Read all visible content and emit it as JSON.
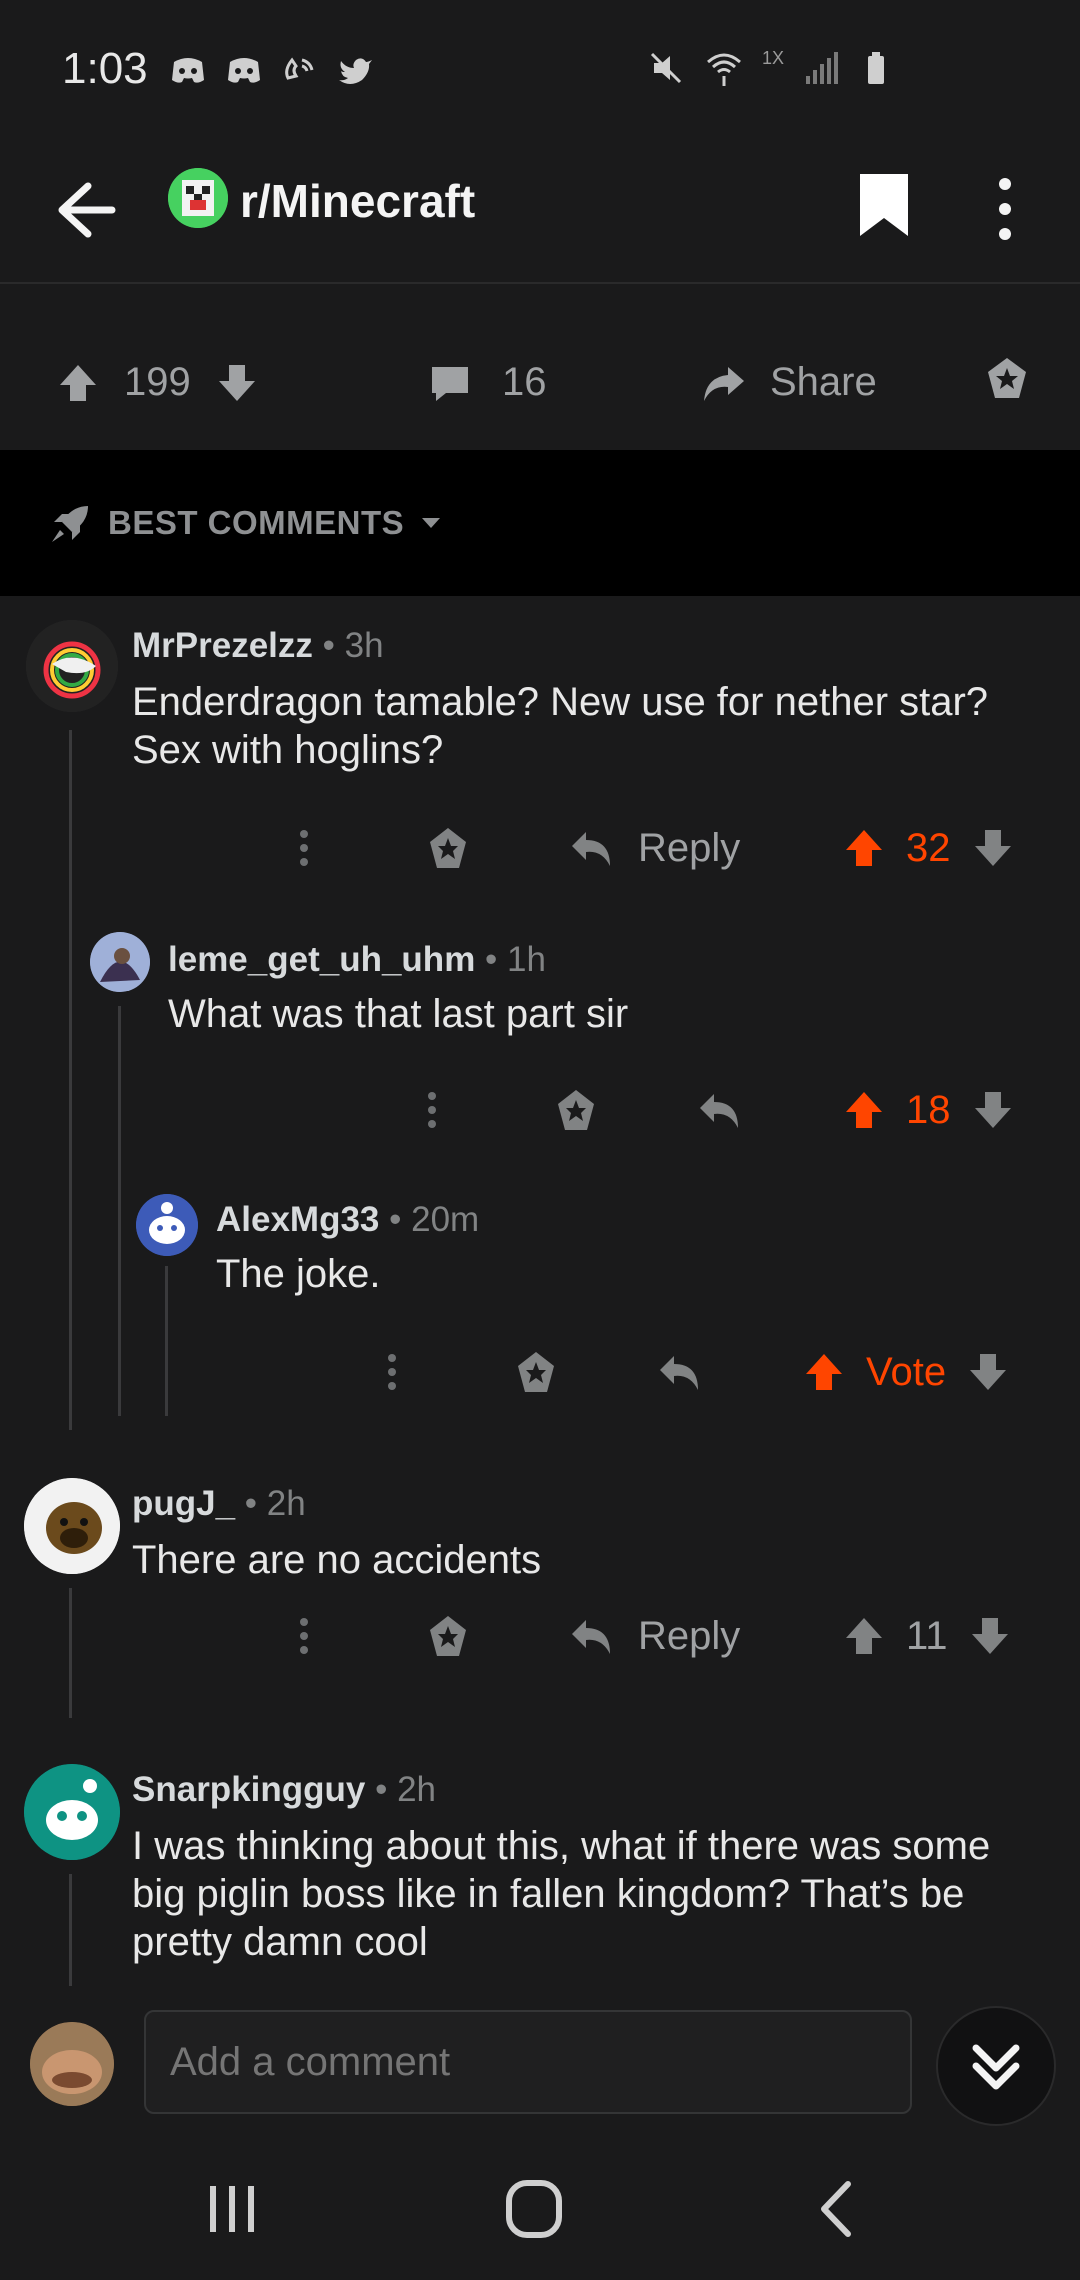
{
  "status_bar": {
    "time": "1:03",
    "network_label": "1X",
    "left_icons": [
      "discord-icon",
      "discord-icon",
      "wifi-call-icon",
      "twitter-icon"
    ],
    "right_icons": [
      "mute-icon",
      "wifi-icon",
      "signal-icon",
      "battery-icon"
    ]
  },
  "header": {
    "subreddit": "r/Minecraft",
    "back_icon": "arrow-left-icon",
    "bookmark_icon": "bookmark-icon",
    "more_icon": "more-vertical-icon"
  },
  "post_actions": {
    "score": "199",
    "comments": "16",
    "share_label": "Share"
  },
  "sort": {
    "label": "BEST COMMENTS"
  },
  "comments": [
    {
      "author": "MrPrezelzz",
      "meta": " • 3h",
      "body": "Enderdragon tamable? New use for nether star? Sex with hoglins?",
      "reply_label": "Reply",
      "score": "32",
      "upvoted": true,
      "replies": [
        {
          "author": "leme_get_uh_uhm",
          "meta": " • 1h",
          "body": "What was that last part sir",
          "score": "18",
          "upvoted": true,
          "replies": [
            {
              "author": "AlexMg33",
              "meta": " • 20m",
              "body": "The joke.",
              "score": "Vote",
              "upvoted": true
            }
          ]
        }
      ]
    },
    {
      "author": "pugJ_",
      "meta": " • 2h",
      "body": "There are no accidents",
      "reply_label": "Reply",
      "score": "11",
      "upvoted": false
    },
    {
      "author": "Snarpkingguy",
      "meta": " • 2h",
      "body": "I was thinking about this, what if there was some big piglin boss like in fallen kingdom? That’s be pretty damn cool"
    }
  ],
  "composer": {
    "placeholder": "Add a comment"
  },
  "colors": {
    "upvote": "#ff4500",
    "background": "#1a1a1b",
    "muted": "#818384"
  }
}
